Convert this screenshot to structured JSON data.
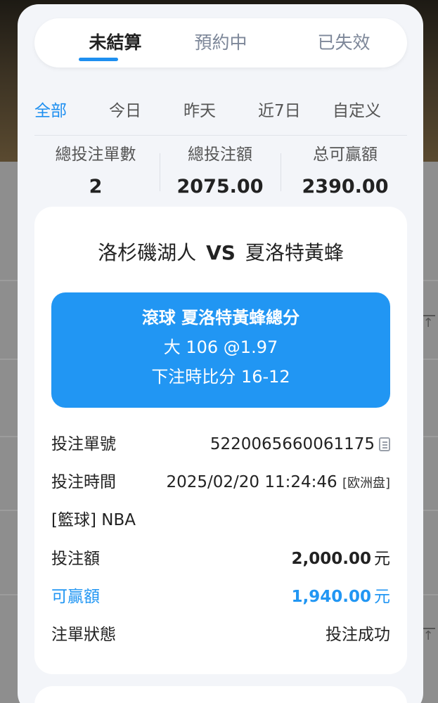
{
  "status_tabs": [
    {
      "label": "未結算",
      "active": true
    },
    {
      "label": "預約中",
      "active": false
    },
    {
      "label": "已失效",
      "active": false
    }
  ],
  "date_filters": [
    {
      "label": "全部",
      "active": true
    },
    {
      "label": "今日",
      "active": false
    },
    {
      "label": "昨天",
      "active": false
    },
    {
      "label": "近7日",
      "active": false
    },
    {
      "label": "自定义",
      "active": false
    }
  ],
  "stats": {
    "total_bets_label": "總投注單數",
    "total_bets_value": "2",
    "total_amount_label": "總投注額",
    "total_amount_value": "2075.00",
    "total_winnable_label": "总可贏額",
    "total_winnable_value": "2390.00"
  },
  "bet": {
    "home_team": "洛杉磯湖人",
    "vs": "VS",
    "away_team": "夏洛特黃蜂",
    "market": "滾球  夏洛特黃蜂總分",
    "selection": "大 106 @1.97",
    "score_at_bet": "下注時比分 16-12",
    "order_no_label": "投注單號",
    "order_no": "5220065660061175",
    "time_label": "投注時間",
    "time": "2025/02/20 11:24:46",
    "odds_type": "[欧洲盘]",
    "league": "[籃球] NBA",
    "stake_label": "投注額",
    "stake": "2,000.00",
    "winnable_label": "可贏額",
    "winnable": "1,940.00",
    "currency": "元",
    "status_label": "注單狀態",
    "status": "投注成功"
  },
  "colors": {
    "accent": "#2196f3",
    "tab_indicator": "#1e8ff0",
    "card_bg": "#ffffff",
    "modal_bg": "#f3f5f9"
  },
  "icons": {
    "copy": "copy-icon"
  }
}
